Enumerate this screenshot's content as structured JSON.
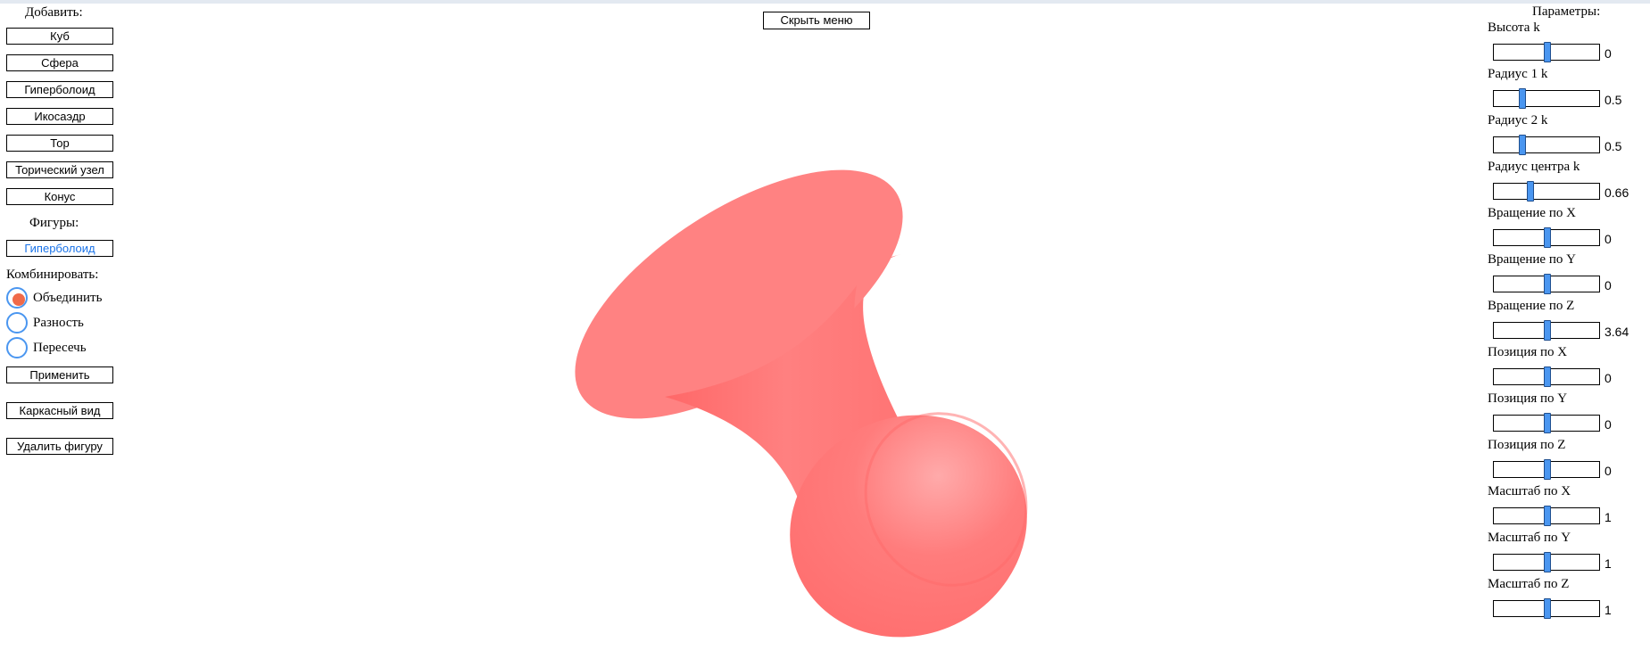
{
  "left_panel": {
    "add_title": "Добавить:",
    "add_buttons": [
      "Куб",
      "Сфера",
      "Гиперболоид",
      "Икосаэдр",
      "Тор",
      "Торический узел",
      "Конус"
    ],
    "figures_title": "Фигуры:",
    "figures": [
      {
        "label": "Гиперболоид",
        "selected": true
      }
    ],
    "combine_title": "Комбинировать:",
    "combine_options": [
      {
        "label": "Объединить",
        "checked": true
      },
      {
        "label": "Разность",
        "checked": false
      },
      {
        "label": "Пересечь",
        "checked": false
      }
    ],
    "apply_label": "Применить",
    "wireframe_label": "Каркасный вид",
    "delete_label": "Удалить фигуру"
  },
  "top": {
    "hide_menu_label": "Скрыть меню"
  },
  "viewport": {
    "shape_color": "#ff7b7b"
  },
  "right_panel": {
    "title": "Параметры:",
    "sliders": [
      {
        "label": "Высота k",
        "value": "0",
        "position": 0.5
      },
      {
        "label": "Радиус 1 k",
        "value": "0.5",
        "position": 0.25
      },
      {
        "label": "Радиус 2 k",
        "value": "0.5",
        "position": 0.25
      },
      {
        "label": "Радиус центра k",
        "value": "0.66",
        "position": 0.33
      },
      {
        "label": "Вращение по X",
        "value": "0",
        "position": 0.5
      },
      {
        "label": "Вращение по Y",
        "value": "0",
        "position": 0.5
      },
      {
        "label": "Вращение по Z",
        "value": "3.64",
        "position": 0.5
      },
      {
        "label": "Позиция по X",
        "value": "0",
        "position": 0.5
      },
      {
        "label": "Позиция по Y",
        "value": "0",
        "position": 0.5
      },
      {
        "label": "Позиция по Z",
        "value": "0",
        "position": 0.5
      },
      {
        "label": "Масштаб по X",
        "value": "1",
        "position": 0.5
      },
      {
        "label": "Масштаб по Y",
        "value": "1",
        "position": 0.5
      },
      {
        "label": "Масштаб по Z",
        "value": "1",
        "position": 0.5
      }
    ]
  },
  "colors": {
    "accent": "#4a96f0",
    "radio_checked": "#f06a4a",
    "selected_figure_text": "#1a73e8"
  }
}
